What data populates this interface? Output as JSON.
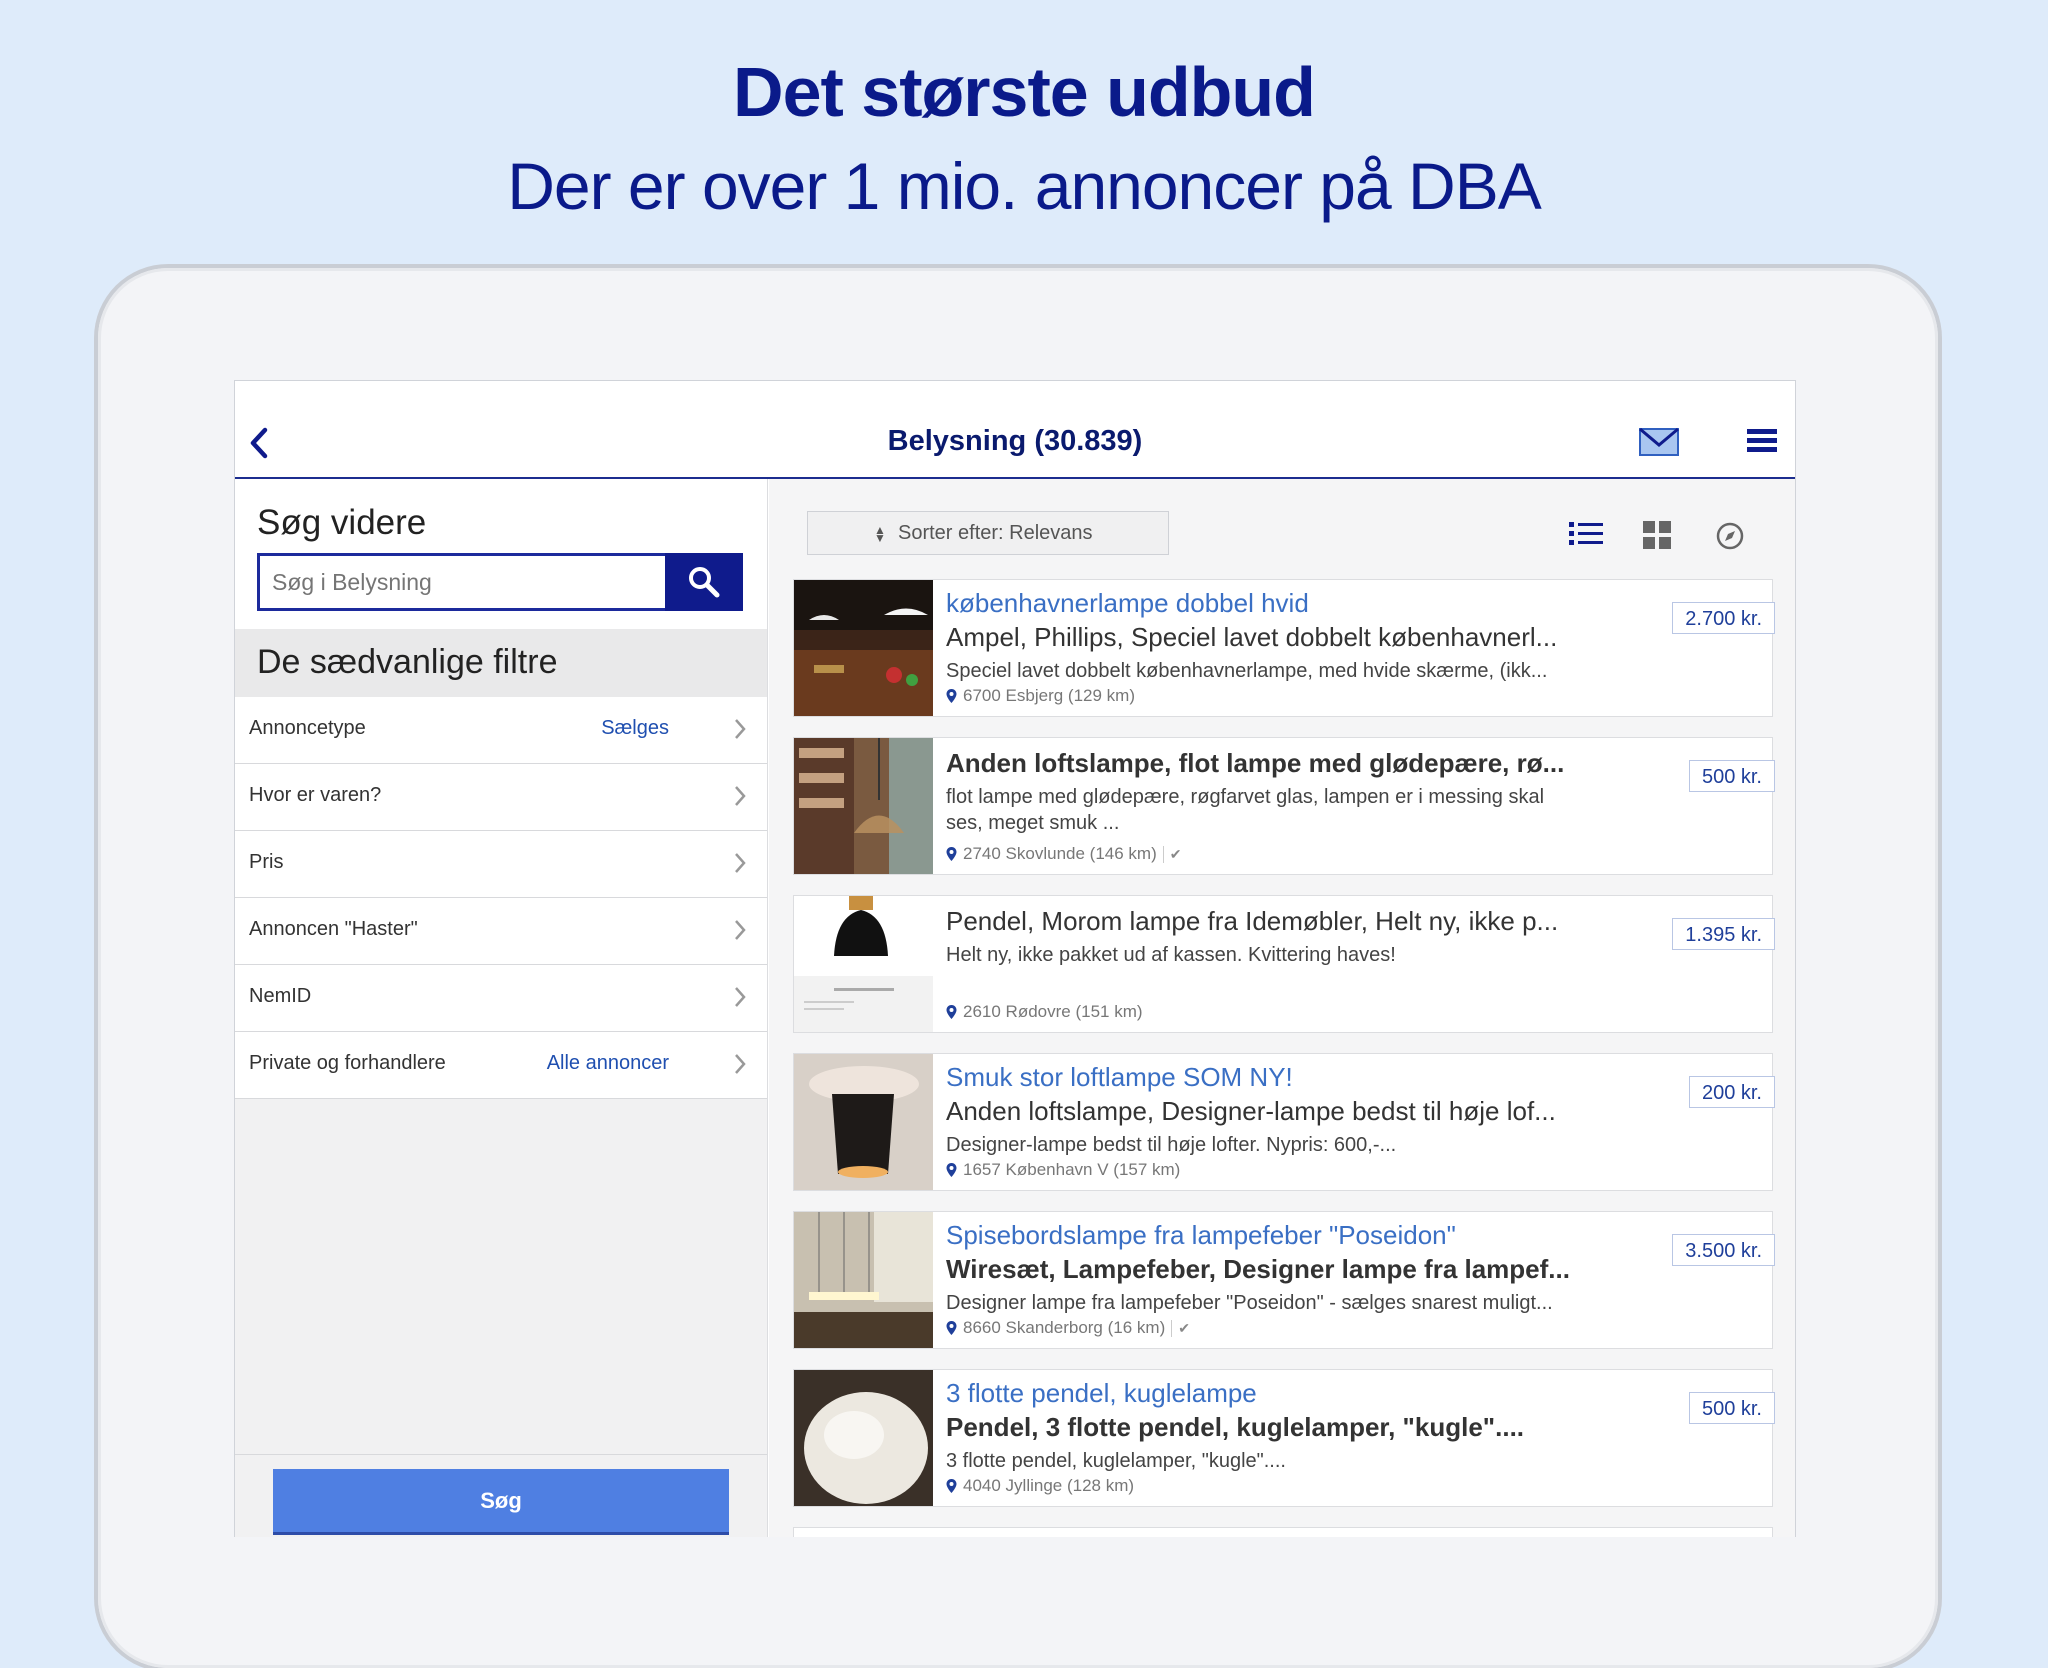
{
  "promo": {
    "title": "Det største udbud",
    "subtitle": "Der er over 1 mio. annoncer på DBA"
  },
  "header": {
    "title": "Belysning (30.839)",
    "icons": [
      "chevron-left-icon",
      "mail-icon",
      "hamburger-menu-icon"
    ]
  },
  "search": {
    "heading": "Søg videre",
    "placeholder": "Søg i Belysning",
    "button_icon": "search-icon"
  },
  "filters": {
    "heading": "De sædvanlige filtre",
    "items": [
      {
        "label": "Annoncetype",
        "value": "Sælges"
      },
      {
        "label": "Hvor er varen?",
        "value": ""
      },
      {
        "label": "Pris",
        "value": ""
      },
      {
        "label": "Annoncen \"Haster\"",
        "value": ""
      },
      {
        "label": "NemID",
        "value": ""
      },
      {
        "label": "Private og forhandlere",
        "value": "Alle annoncer"
      }
    ],
    "submit_label": "Søg"
  },
  "toolbar": {
    "sort_label": "Sorter efter: Relevans",
    "view_icons": [
      "list-view-icon",
      "grid-view-icon",
      "compass-icon"
    ]
  },
  "listings": [
    {
      "title_link": "københavnerlampe dobbel hvid",
      "subtitle": "Ampel, Phillips, Speciel lavet dobbelt københavnerl...",
      "subtitle_bold": false,
      "description": "Speciel lavet dobbelt københavnerlampe, med hvide skærme, (ikk...",
      "location": "6700 Esbjerg (129 km)",
      "verified": false,
      "price": "2.700 kr."
    },
    {
      "title_link": "",
      "subtitle": "Anden loftslampe, flot lampe med glødepære, rø...",
      "subtitle_bold": true,
      "description": "flot lampe med glødepære, røgfarvet glas,  lampen er   i messing skal ses, meget smuk ...",
      "location": "2740 Skovlunde (146 km)",
      "verified": true,
      "price": "500 kr."
    },
    {
      "title_link": "",
      "subtitle": "Pendel, Morom lampe fra Idemøbler, Helt ny, ikke p...",
      "subtitle_bold": false,
      "description": "Helt ny, ikke pakket ud af kassen. Kvittering haves!",
      "location": "2610 Rødovre (151 km)",
      "verified": false,
      "price": "1.395 kr."
    },
    {
      "title_link": "Smuk stor loftlampe SOM NY!",
      "subtitle": "Anden loftslampe, Designer-lampe bedst til høje lof...",
      "subtitle_bold": false,
      "description": "Designer-lampe bedst til høje lofter. Nypris: 600,-...",
      "location": "1657 København V (157 km)",
      "verified": false,
      "price": "200 kr."
    },
    {
      "title_link": "Spisebordslampe fra lampefeber \"Poseidon\"",
      "subtitle": "Wiresæt, Lampefeber, Designer lampe fra lampef...",
      "subtitle_bold": true,
      "description": "Designer lampe fra lampefeber \"Poseidon\" - sælges snarest muligt...",
      "location": "8660 Skanderborg (16 km)",
      "verified": true,
      "price": "3.500 kr."
    },
    {
      "title_link": "3 flotte pendel, kuglelampe",
      "subtitle": "Pendel, 3 flotte pendel, kuglelamper, \"kugle\"....",
      "subtitle_bold": true,
      "description": "3 flotte pendel, kuglelamper, \"kugle\"....",
      "location": "4040 Jyllinge (128 km)",
      "verified": false,
      "price": "500 kr."
    }
  ],
  "colors": {
    "background": "#deebfa",
    "brand_navy": "#0a1a8a",
    "link_blue": "#3a6fc4",
    "submit_blue": "#4f7fe2"
  }
}
